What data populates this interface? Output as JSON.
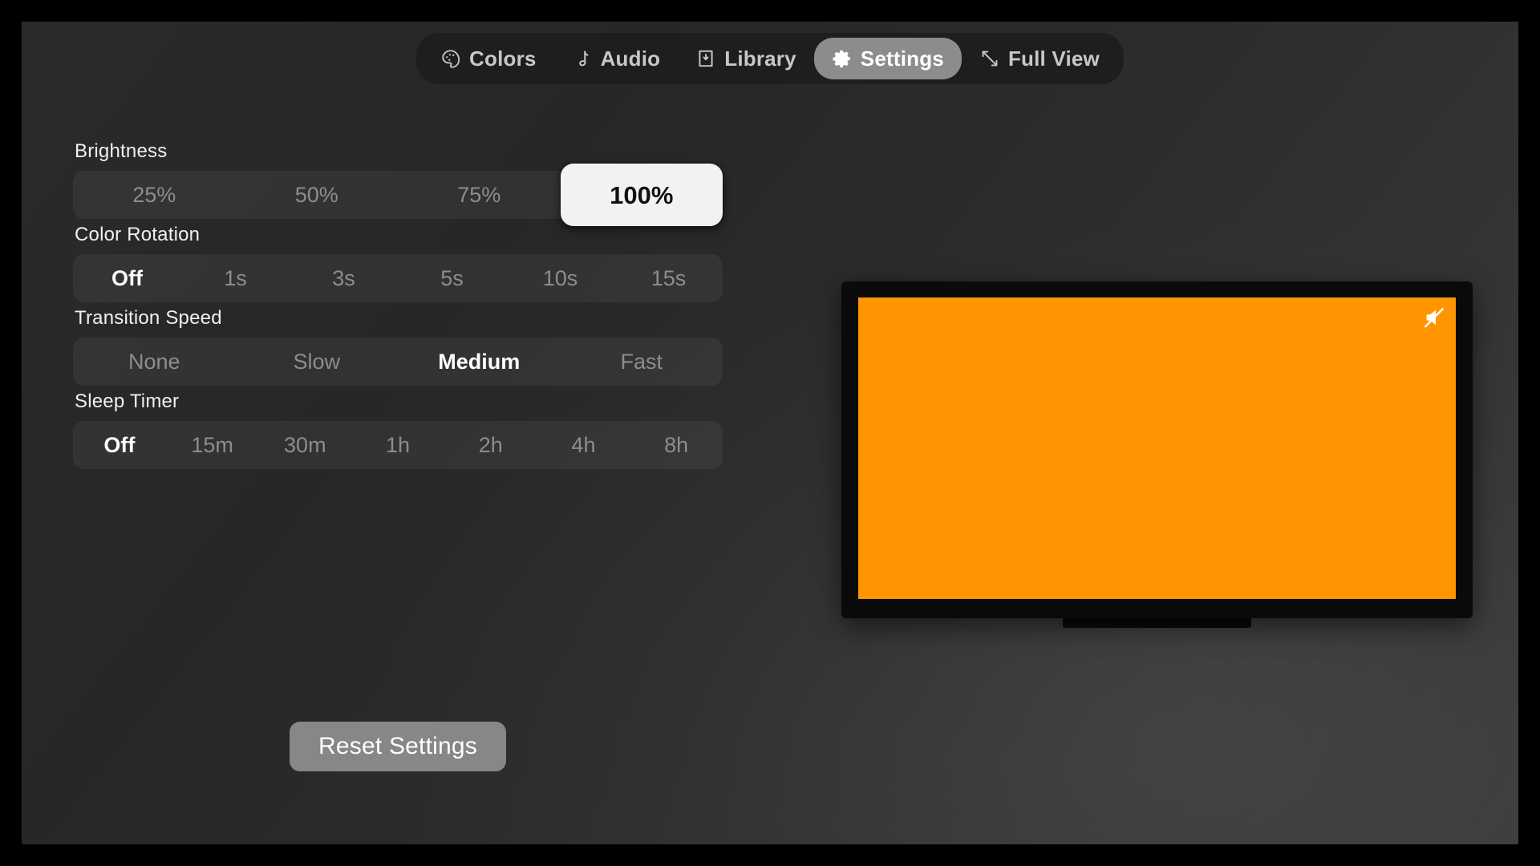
{
  "nav": {
    "items": [
      {
        "label": "Colors",
        "icon": "palette-icon",
        "active": false
      },
      {
        "label": "Audio",
        "icon": "music-note-icon",
        "active": false
      },
      {
        "label": "Library",
        "icon": "library-icon",
        "active": false
      },
      {
        "label": "Settings",
        "icon": "gear-icon",
        "active": true
      },
      {
        "label": "Full View",
        "icon": "expand-icon",
        "active": false
      }
    ]
  },
  "settings": {
    "groups": [
      {
        "key": "brightness",
        "label": "Brightness",
        "style": "pill",
        "options": [
          "25%",
          "50%",
          "75%",
          "100%"
        ],
        "selected": "100%"
      },
      {
        "key": "color_rotation",
        "label": "Color Rotation",
        "style": "text",
        "options": [
          "Off",
          "1s",
          "3s",
          "5s",
          "10s",
          "15s"
        ],
        "selected": "Off"
      },
      {
        "key": "transition_speed",
        "label": "Transition Speed",
        "style": "text",
        "options": [
          "None",
          "Slow",
          "Medium",
          "Fast"
        ],
        "selected": "Medium"
      },
      {
        "key": "sleep_timer",
        "label": "Sleep Timer",
        "style": "text",
        "options": [
          "Off",
          "15m",
          "30m",
          "1h",
          "2h",
          "4h",
          "8h"
        ],
        "selected": "Off"
      }
    ],
    "reset_label": "Reset Settings"
  },
  "preview": {
    "screen_color": "#FF9500",
    "muted": true,
    "mute_icon": "speaker-muted-icon",
    "bezel_color": "#0a0a0a"
  },
  "colors": {
    "accent": "#FF9500",
    "active_tab_bg": "#8c8c8c",
    "selected_pill_bg": "#f2f2f0",
    "reset_button_bg": "#878787",
    "page_border": "#000000"
  }
}
